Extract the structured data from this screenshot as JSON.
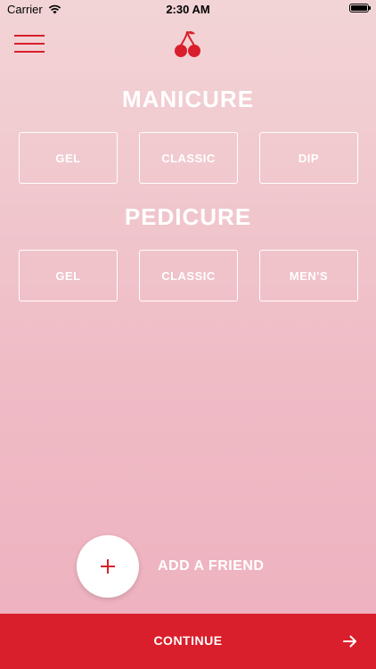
{
  "status_bar": {
    "carrier": "Carrier",
    "time": "2:30 AM",
    "icons": [
      "wifi-icon",
      "battery-icon"
    ]
  },
  "header": {
    "menu_icon": "hamburger-menu-icon",
    "logo_icon": "cherry-logo-icon"
  },
  "manicure": {
    "title": "MANICURE",
    "options": [
      "GEL",
      "CLASSIC",
      "DIP"
    ]
  },
  "pedicure": {
    "title": "PEDICURE",
    "options": [
      "GEL",
      "CLASSIC",
      "MEN'S"
    ]
  },
  "add_friend": {
    "icon": "plus-icon",
    "label": "ADD A FRIEND"
  },
  "footer": {
    "continue_label": "CONTINUE",
    "arrow_icon": "arrow-right-icon"
  },
  "colors": {
    "accent": "#d91f2b",
    "background_top": "#f2d4d6",
    "background_bottom": "#eeb0be",
    "text_light": "#ffffff"
  }
}
